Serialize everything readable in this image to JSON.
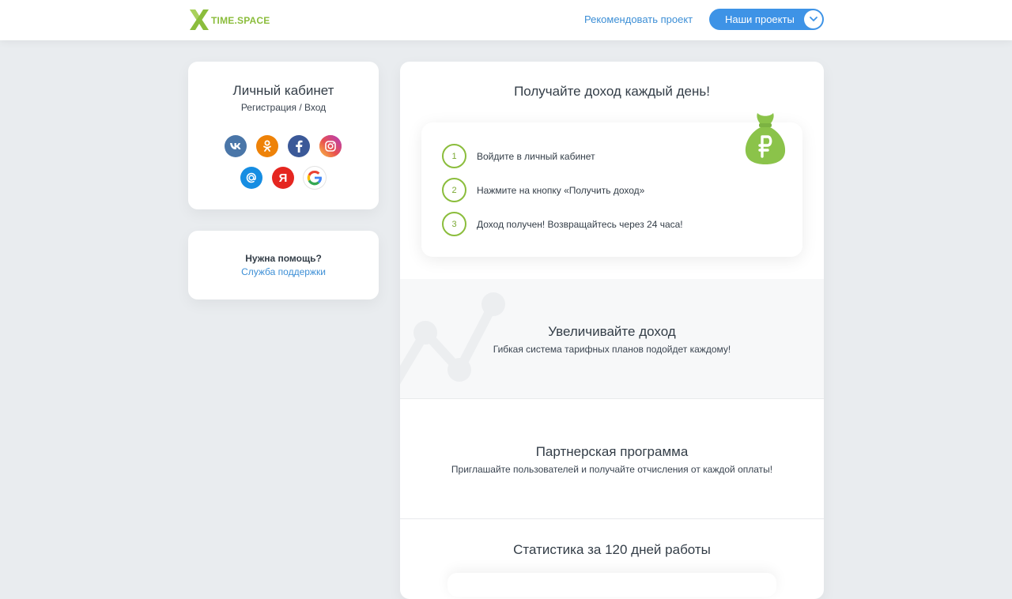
{
  "header": {
    "logo_text": "TIME.SPACE",
    "recommend_link": "Рекомендовать проект",
    "projects_button": "Наши проекты",
    "accent_color": "#3e93e6",
    "brand_color": "#8bbd3c"
  },
  "cabinet": {
    "title": "Личный кабинет",
    "register": "Регистрация",
    "separator": " / ",
    "login": "Вход",
    "socials": [
      {
        "name": "vk",
        "color": "#4a76a8",
        "glyph": "vk"
      },
      {
        "name": "odnoklassniki",
        "color": "#ee8208",
        "glyph": "ok"
      },
      {
        "name": "facebook",
        "color": "#3b5998",
        "glyph": "f"
      },
      {
        "name": "instagram",
        "color": "#d6249f",
        "glyph": "ig"
      },
      {
        "name": "mail-ru",
        "color": "#168de2",
        "glyph": "@"
      },
      {
        "name": "yandex",
        "color": "#e52620",
        "glyph": "Я"
      },
      {
        "name": "google",
        "color": "#ffffff",
        "glyph": "G"
      }
    ]
  },
  "help": {
    "title": "Нужна помощь?",
    "link": "Служба поддержки"
  },
  "main": {
    "title": "Получайте доход каждый день!",
    "steps": [
      {
        "num": "1",
        "text": "Войдите в личный кабинет"
      },
      {
        "num": "2",
        "text": "Нажмите на кнопку «Получить доход»"
      },
      {
        "num": "3",
        "text": "Доход получен! Возвращайтесь через 24 часа!"
      }
    ],
    "increase": {
      "title": "Увеличивайте доход",
      "subtitle": "Гибкая система тарифных планов подойдет каждому!"
    },
    "partner": {
      "title": "Партнерская программа",
      "subtitle": "Приглашайте пользователей и получайте отчисления от каждой оплаты!"
    },
    "stats": {
      "title": "Статистика за 120 дней работы"
    }
  }
}
